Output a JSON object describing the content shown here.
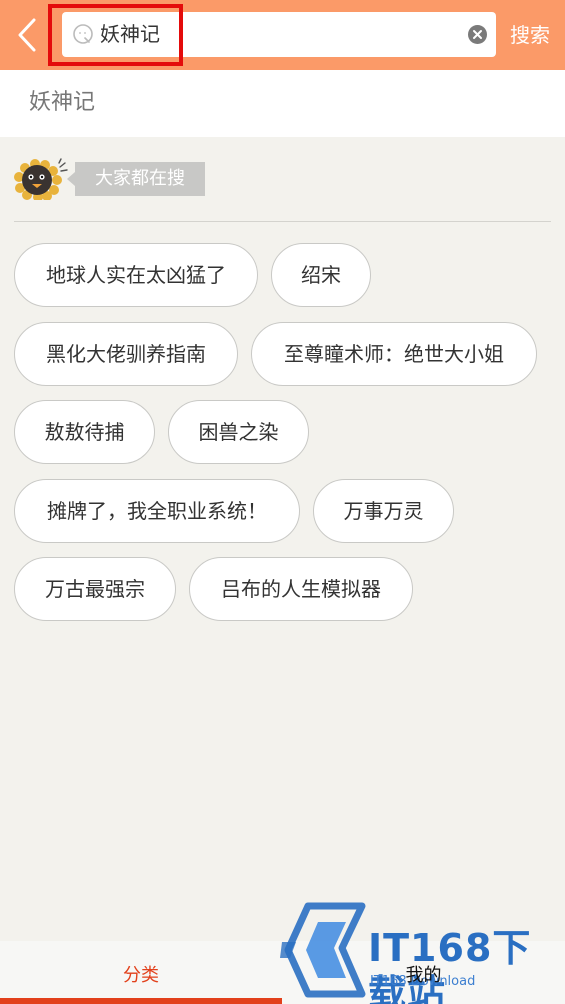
{
  "header": {
    "search_value": "妖神记",
    "search_button": "搜索"
  },
  "suggestion": "妖神记",
  "section": {
    "title": "大家都在搜"
  },
  "tags": [
    "地球人实在太凶猛了",
    "绍宋",
    "黑化大佬驯养指南",
    "至尊瞳术师：绝世大小姐",
    "敖敖待捕",
    "困兽之染",
    "摊牌了，我全职业系统！",
    "万事万灵",
    "万古最强宗",
    "吕布的人生模拟器"
  ],
  "bottom_nav": [
    {
      "label": "分类",
      "active": true
    },
    {
      "label": "我的",
      "active": false
    }
  ],
  "watermark": {
    "main": "IT168下载站",
    "sub": "IT168 Download"
  },
  "colors": {
    "header_bg": "#fb9a68",
    "highlight_border": "#e40b0b",
    "active_nav": "#e2401b",
    "page_bg": "#f3f2ed"
  }
}
